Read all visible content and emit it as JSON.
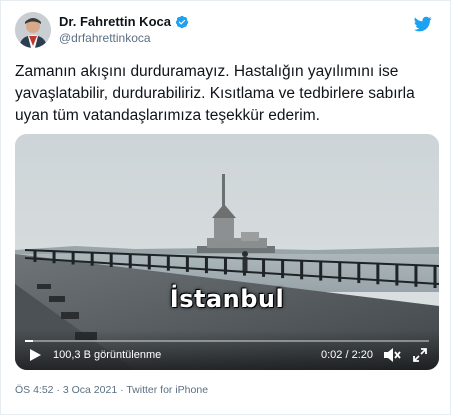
{
  "author": {
    "name": "Dr. Fahrettin Koca",
    "handle": "@drfahrettinkoca",
    "verified": true
  },
  "tweet": {
    "text": "Zamanın akışını durduramayız. Hastalığın yayılımını ise yavaşlatabilir, durdurabiliriz. Kısıtlama ve tedbirlere sabırla uyan tüm vatandaşlarımıza teşekkür ederim."
  },
  "video": {
    "caption": "İstanbul",
    "views": "100,3 B görüntülenme",
    "time": "0:02 / 2:20",
    "progress": 0.02
  },
  "meta": {
    "time": "ÖS 4:52",
    "separator": "·",
    "date": "3 Oca 2021",
    "source": "Twitter for iPhone"
  },
  "colors": {
    "twitter_blue": "#1da1f2",
    "secondary_text": "#5b7083",
    "border": "#e6ecf0"
  },
  "icons": [
    "twitter-logo-icon",
    "verified-badge-icon",
    "play-icon",
    "mute-icon",
    "fullscreen-icon"
  ]
}
